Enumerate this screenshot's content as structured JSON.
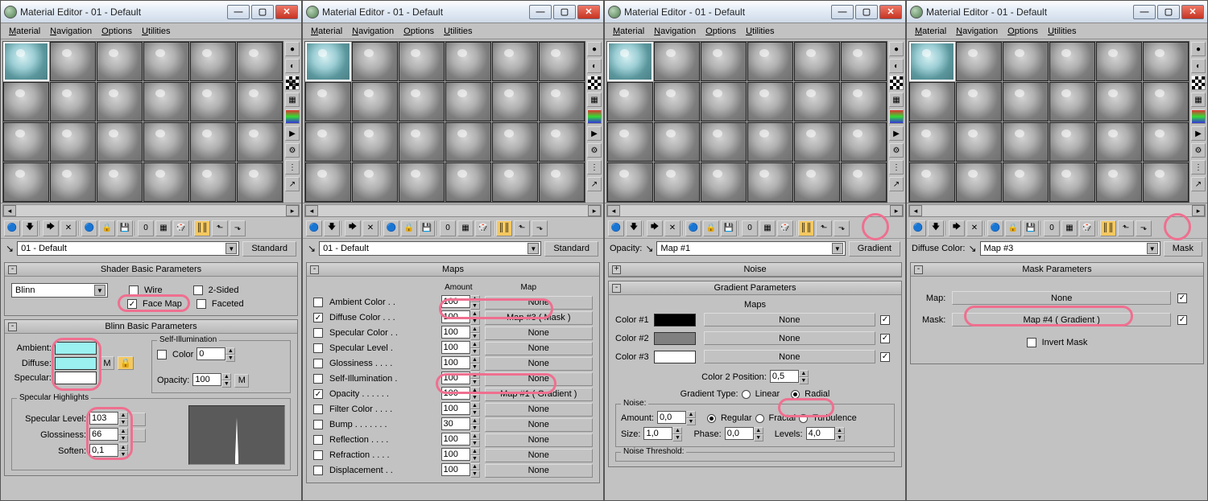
{
  "title": "Material Editor - 01 - Default",
  "menu": {
    "material": "Material",
    "navigation": "Navigation",
    "options": "Options",
    "utilities": "Utilities"
  },
  "toolbar_icons": [
    "apply",
    "put",
    "sep",
    "pick",
    "clear",
    "sep",
    "make",
    "pin",
    "show",
    "sep",
    "opts",
    "select",
    "sep",
    "view1",
    "view2",
    "sep",
    "up",
    "fwd"
  ],
  "name_row_pick": "⌖",
  "panels": [
    {
      "name": "01 - Default",
      "type_btn": "Standard",
      "shader_basic": {
        "hdr": "Shader Basic Parameters",
        "shader": "Blinn",
        "wire": "Wire",
        "face_map": "Face Map",
        "two_sided": "2-Sided",
        "faceted": "Faceted",
        "face_map_on": true
      },
      "blinn_basic": {
        "hdr": "Blinn Basic Parameters",
        "ambient": "Ambient:",
        "diffuse": "Diffuse:",
        "specular": "Specular:",
        "self_illum": "Self-Illumination",
        "color_lbl": "Color",
        "color_val": "0",
        "opacity_lbl": "Opacity:",
        "opacity_val": "100",
        "spec_hdr": "Specular Highlights",
        "spec_level_lbl": "Specular Level:",
        "spec_level": "103",
        "gloss_lbl": "Glossiness:",
        "gloss": "66",
        "soften_lbl": "Soften:",
        "soften": "0,1"
      }
    },
    {
      "name": "01 - Default",
      "type_btn": "Standard",
      "maps": {
        "hdr": "Maps",
        "col_amount": "Amount",
        "col_map": "Map",
        "rows": [
          {
            "n": "Ambient Color . .",
            "a": "100",
            "m": "None"
          },
          {
            "n": "Diffuse Color . . .",
            "a": "100",
            "m": "Map #3  ( Mask )",
            "on": true
          },
          {
            "n": "Specular Color . .",
            "a": "100",
            "m": "None"
          },
          {
            "n": "Specular Level .",
            "a": "100",
            "m": "None"
          },
          {
            "n": "Glossiness . . . .",
            "a": "100",
            "m": "None"
          },
          {
            "n": "Self-Illumination .",
            "a": "100",
            "m": "None"
          },
          {
            "n": "Opacity . . . . . .",
            "a": "100",
            "m": "Map #1  ( Gradient )",
            "on": true
          },
          {
            "n": "Filter Color . . . .",
            "a": "100",
            "m": "None"
          },
          {
            "n": "Bump . . . . . . .",
            "a": "30",
            "m": "None"
          },
          {
            "n": "Reflection . . . .",
            "a": "100",
            "m": "None"
          },
          {
            "n": "Refraction . . . .",
            "a": "100",
            "m": "None"
          },
          {
            "n": "Displacement . .",
            "a": "100",
            "m": "None"
          }
        ]
      }
    },
    {
      "slot_label": "Opacity:",
      "name": "Map #1",
      "type_btn": "Gradient",
      "noise_hdr": "Noise",
      "grad": {
        "hdr": "Gradient Parameters",
        "maps_lbl": "Maps",
        "c1": "Color #1",
        "c2": "Color #2",
        "c3": "Color #3",
        "none": "None",
        "c2pos_lbl": "Color 2 Position:",
        "c2pos": "0,5",
        "type_lbl": "Gradient Type:",
        "linear": "Linear",
        "radial": "Radial",
        "noise_lbl": "Noise:",
        "amount_lbl": "Amount:",
        "amount": "0,0",
        "regular": "Regular",
        "fractal": "Fractal",
        "turb": "Turbulence",
        "size_lbl": "Size:",
        "size": "1,0",
        "phase_lbl": "Phase:",
        "phase": "0,0",
        "levels_lbl": "Levels:",
        "levels": "4,0",
        "nth": "Noise Threshold:"
      }
    },
    {
      "slot_label": "Diffuse Color:",
      "name": "Map #3",
      "type_btn": "Mask",
      "mask": {
        "hdr": "Mask Parameters",
        "map_lbl": "Map:",
        "map_val": "None",
        "mask_lbl": "Mask:",
        "mask_val": "Map #4  ( Gradient )",
        "invert": "Invert Mask"
      }
    }
  ]
}
